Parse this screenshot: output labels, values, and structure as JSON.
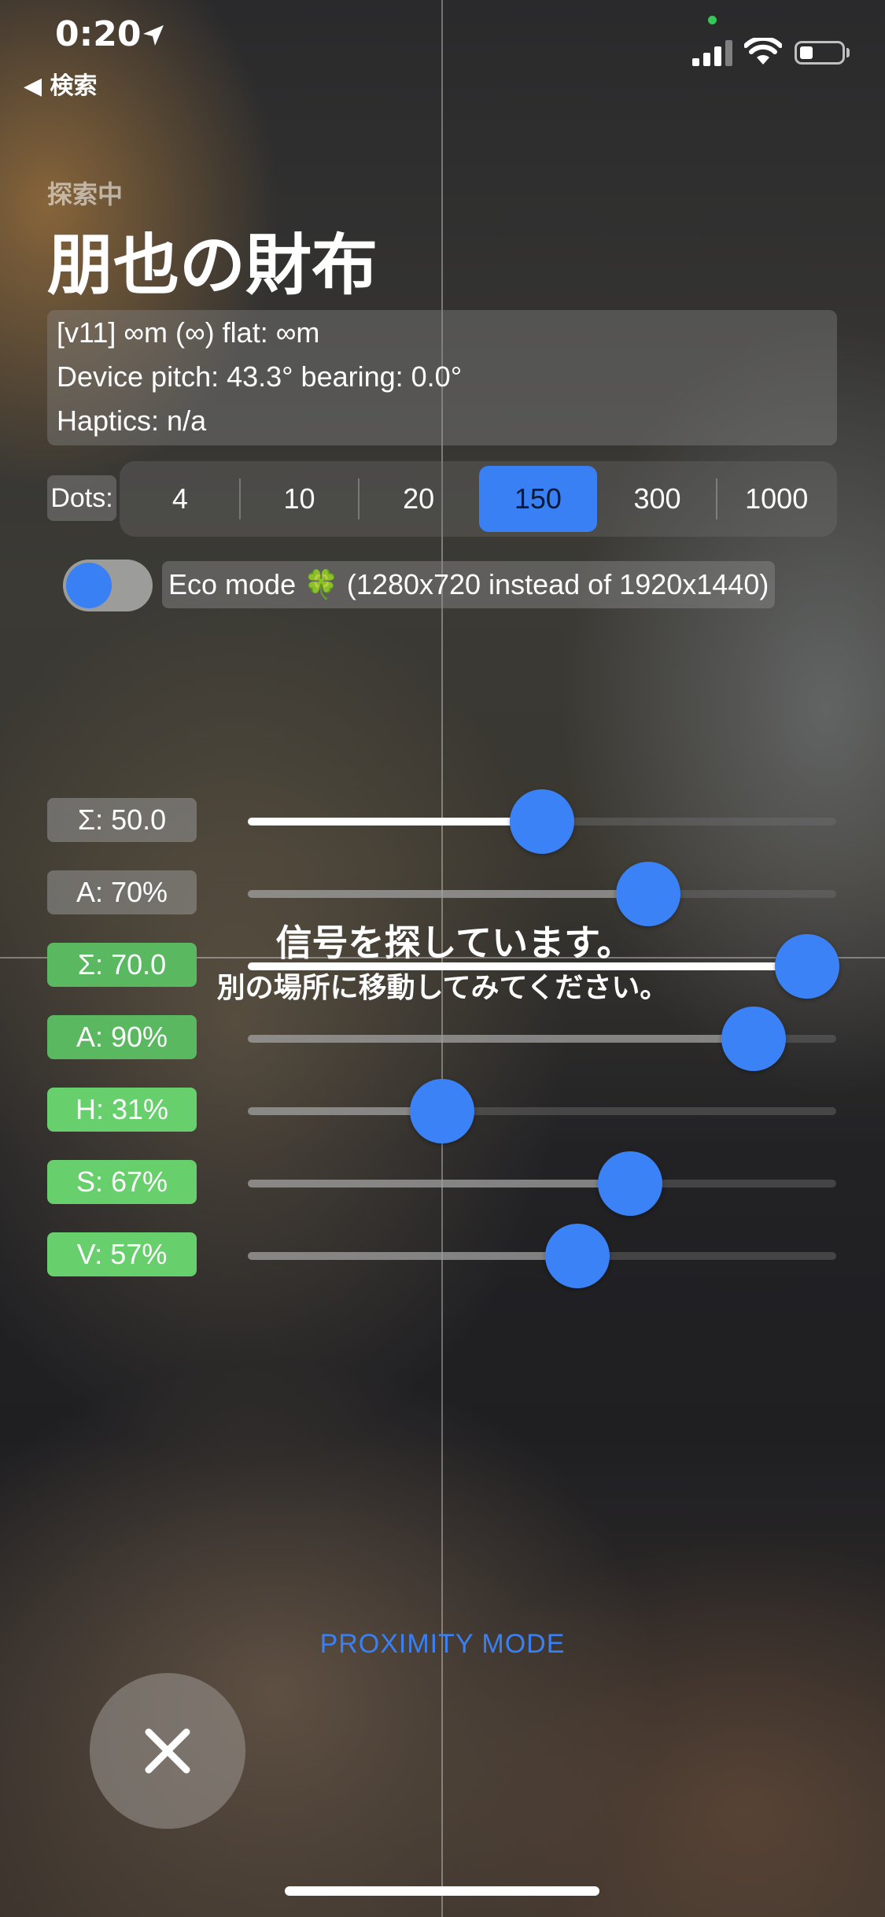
{
  "status_bar": {
    "time": "0:20",
    "back_label": "◀ 検索",
    "icons": [
      "location-arrow-icon",
      "signal-icon",
      "wifi-icon",
      "battery-icon"
    ]
  },
  "header": {
    "subtitle": "探索中",
    "title": "朋也の財布"
  },
  "info": {
    "line1": "[v11] ∞m (∞) flat: ∞m",
    "line2": "Device pitch: 43.3° bearing: 0.0°",
    "line3": "Haptics: n/a"
  },
  "dots": {
    "label": "Dots:",
    "options": [
      "4",
      "10",
      "20",
      "150",
      "300",
      "1000"
    ],
    "selected": "150"
  },
  "eco": {
    "label": "Eco mode 🍀 (1280x720 instead of 1920x1440)",
    "on": false
  },
  "sliders": [
    {
      "label": "Σ: 50.0",
      "value": 0.5
    },
    {
      "label": "A: 70%",
      "value": 0.68
    },
    {
      "label": "Σ: 70.0",
      "value": 0.95
    },
    {
      "label": "A: 90%",
      "value": 0.86
    },
    {
      "label": "H: 31%",
      "value": 0.33
    },
    {
      "label": "S: 67%",
      "value": 0.65
    },
    {
      "label": "V: 57%",
      "value": 0.56
    }
  ],
  "message": {
    "line1": "信号を探しています。",
    "line2": "別の場所に移動してみてください。"
  },
  "mode_label": "PROXIMITY MODE",
  "colors": {
    "accent": "#3a80f5",
    "green": "#67cf6b"
  }
}
